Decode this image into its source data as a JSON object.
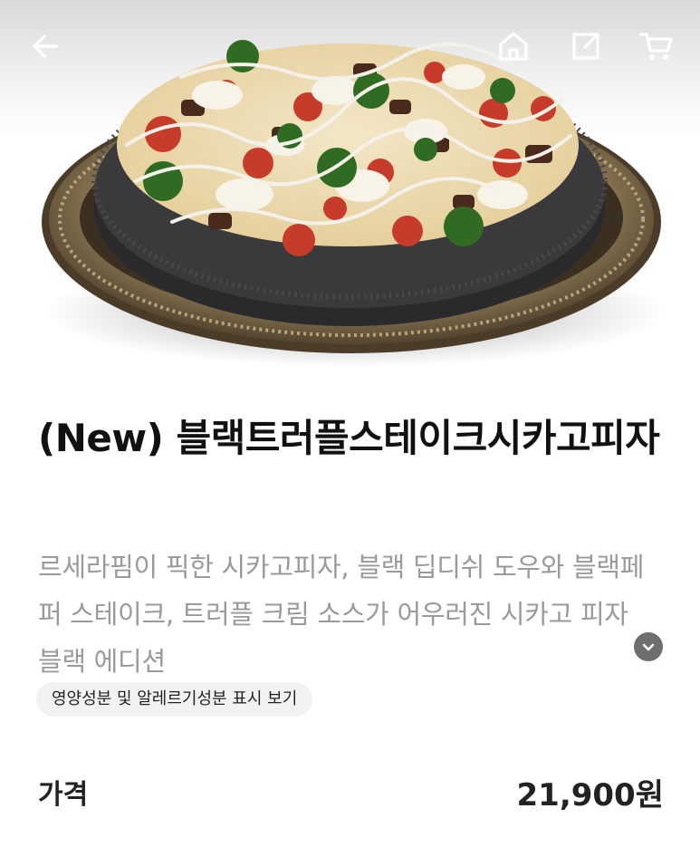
{
  "header": {
    "back_icon": "back-arrow-icon",
    "home_icon": "home-icon",
    "share_icon": "share-icon",
    "cart_icon": "cart-icon"
  },
  "product": {
    "image_subject": "pizza",
    "title": "(New) 블랙트러플스테이크시카고피자",
    "description": "르세라핌이 픽한 시카고피자, 블랙 딥디쉬 도우와 블랙페퍼 스테이크, 트러플 크림 소스가 어우러진 시카고 피자 블랙 에디션",
    "expand_icon": "chevron-down-icon",
    "nutrition_link": "영양성분 및 알레르기성분 표시 보기"
  },
  "price": {
    "label": "가격",
    "value": "21,900원"
  },
  "colors": {
    "text_primary": "#111111",
    "text_secondary": "#9a9a9a",
    "chip_background": "#f2f2f2",
    "expand_button": "#6e6e6e"
  }
}
